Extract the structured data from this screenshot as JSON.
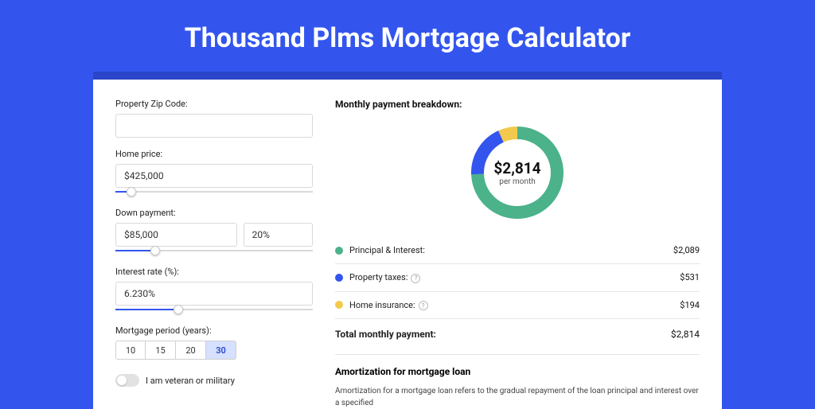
{
  "title": "Thousand Plms Mortgage Calculator",
  "form": {
    "zip_label": "Property Zip Code:",
    "zip_value": "",
    "home_price_label": "Home price:",
    "home_price_value": "$425,000",
    "home_price_slider_pct": 8,
    "down_payment_label": "Down payment:",
    "down_payment_value": "$85,000",
    "down_payment_pct_value": "20%",
    "down_payment_slider_pct": 20,
    "interest_label": "Interest rate (%):",
    "interest_value": "6.230%",
    "interest_slider_pct": 32,
    "period_label": "Mortgage period (years):",
    "periods": [
      "10",
      "15",
      "20",
      "30"
    ],
    "period_selected": "30",
    "veteran_label": "I am veteran or military"
  },
  "breakdown": {
    "title": "Monthly payment breakdown:",
    "center_value": "$2,814",
    "center_sub": "per month",
    "items": [
      {
        "label": "Principal & Interest:",
        "value": "$2,089",
        "color": "#4bb28a",
        "num": 2089,
        "help": false
      },
      {
        "label": "Property taxes:",
        "value": "$531",
        "color": "#3355ee",
        "num": 531,
        "help": true
      },
      {
        "label": "Home insurance:",
        "value": "$194",
        "color": "#f2c94c",
        "num": 194,
        "help": true
      }
    ],
    "total_label": "Total monthly payment:",
    "total_value": "$2,814"
  },
  "amort": {
    "title": "Amortization for mortgage loan",
    "text": "Amortization for a mortgage loan refers to the gradual repayment of the loan principal and interest over a specified"
  },
  "chart_data": {
    "type": "pie",
    "title": "Monthly payment breakdown",
    "categories": [
      "Principal & Interest",
      "Property taxes",
      "Home insurance"
    ],
    "values": [
      2089,
      531,
      194
    ],
    "colors": [
      "#4bb28a",
      "#3355ee",
      "#f2c94c"
    ],
    "total": 2814,
    "center_label": "$2,814 per month"
  }
}
